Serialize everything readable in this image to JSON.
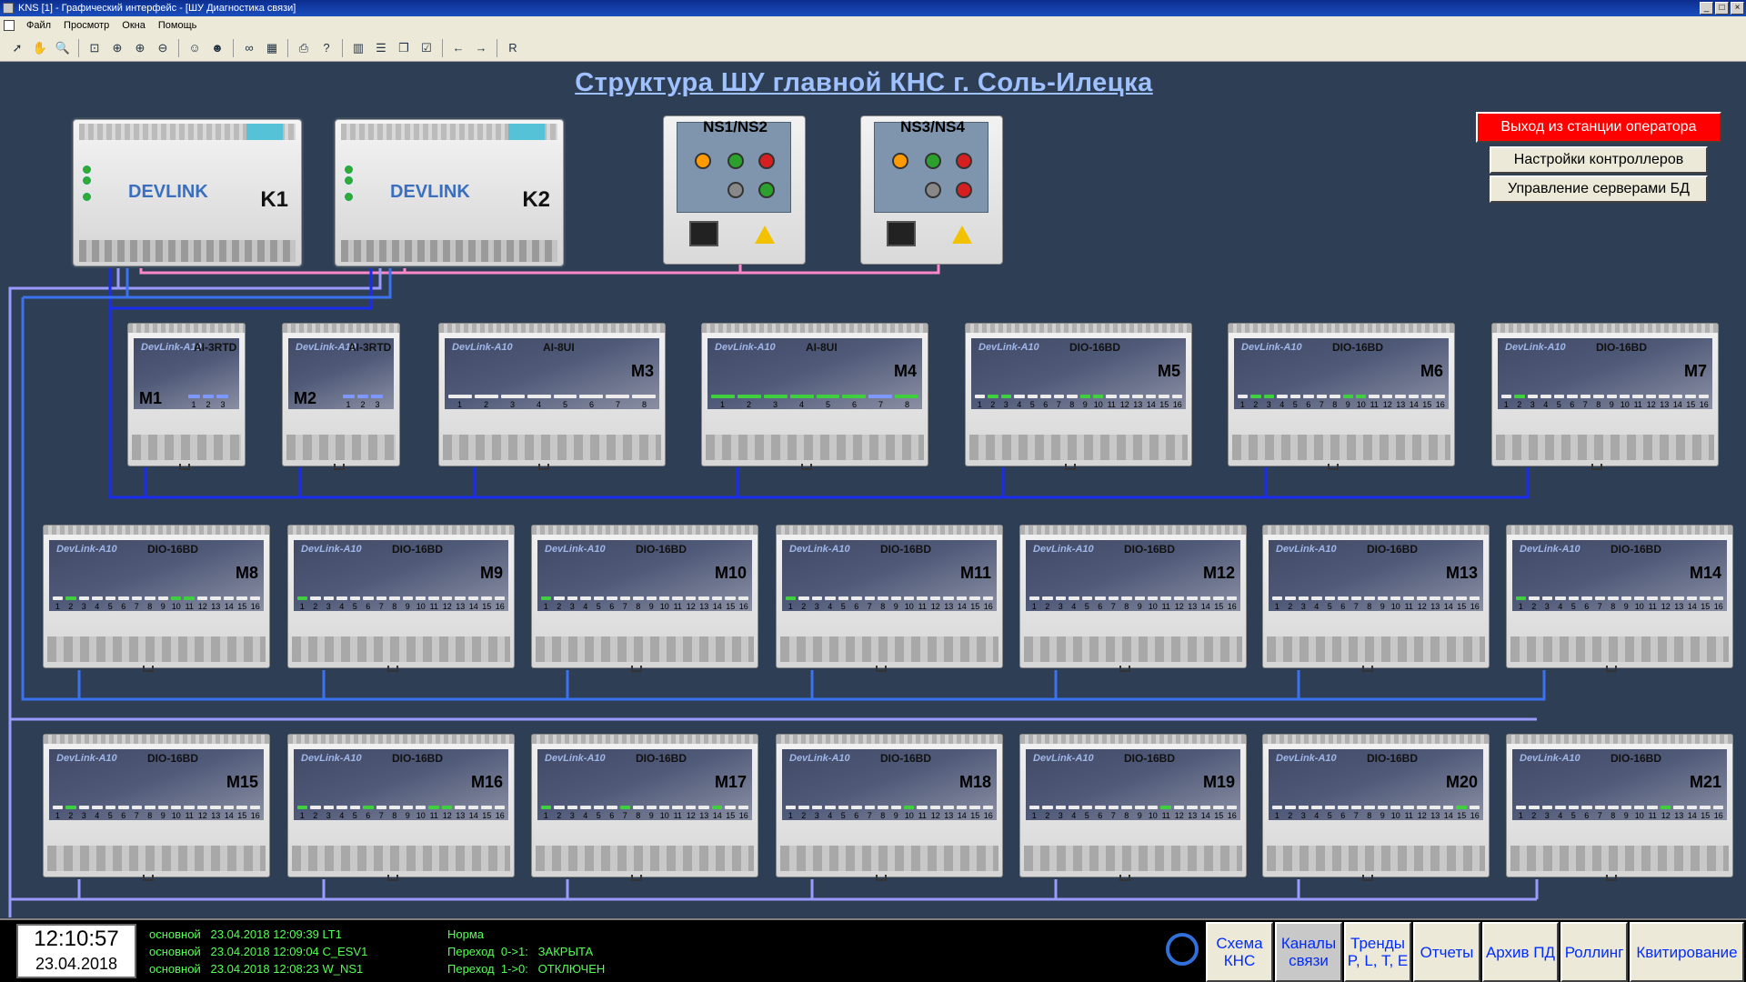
{
  "window": {
    "title": "KNS [1] - Графический интерфейс - [ШУ Диагностика связи]"
  },
  "menu": {
    "items": [
      "Файл",
      "Просмотр",
      "Окна",
      "Помощь"
    ]
  },
  "toolbar": {
    "r_label": "R"
  },
  "screen": {
    "title": "Структура ШУ главной КНС г. Соль-Илецка",
    "controllers": [
      {
        "tag": "K1",
        "brand": "DEVLINK"
      },
      {
        "tag": "K2",
        "brand": "DEVLINK"
      }
    ],
    "relays": [
      {
        "tag": "NS1/NS2"
      },
      {
        "tag": "NS3/NS4"
      }
    ],
    "buttons": {
      "exit": "Выход из станции оператора",
      "controllers": "Настройки контроллеров",
      "db_servers": "Управление серверами БД"
    },
    "modules": [
      {
        "id": "M1",
        "type": "AI-3RTD",
        "n": 3,
        "on": [],
        "blue": [
          0,
          1,
          2
        ]
      },
      {
        "id": "M2",
        "type": "AI-3RTD",
        "n": 3,
        "on": [],
        "blue": [
          0,
          1,
          2
        ]
      },
      {
        "id": "M3",
        "type": "AI-8UI",
        "n": 8,
        "on": [],
        "blue": []
      },
      {
        "id": "M4",
        "type": "AI-8UI",
        "n": 8,
        "on": [
          0,
          1,
          2,
          3,
          4,
          5,
          7
        ],
        "blue": [
          6
        ]
      },
      {
        "id": "M5",
        "type": "DIO-16BD",
        "n": 16,
        "on": [
          1,
          2,
          8,
          9
        ],
        "blue": []
      },
      {
        "id": "M6",
        "type": "DIO-16BD",
        "n": 16,
        "on": [
          1,
          2,
          8,
          9
        ],
        "blue": []
      },
      {
        "id": "M7",
        "type": "DIO-16BD",
        "n": 16,
        "on": [
          1
        ],
        "blue": []
      },
      {
        "id": "M8",
        "type": "DIO-16BD",
        "n": 16,
        "on": [
          1,
          9,
          10
        ],
        "blue": []
      },
      {
        "id": "M9",
        "type": "DIO-16BD",
        "n": 16,
        "on": [
          0
        ],
        "blue": []
      },
      {
        "id": "M10",
        "type": "DIO-16BD",
        "n": 16,
        "on": [
          0
        ],
        "blue": []
      },
      {
        "id": "M11",
        "type": "DIO-16BD",
        "n": 16,
        "on": [
          0
        ],
        "blue": []
      },
      {
        "id": "M12",
        "type": "DIO-16BD",
        "n": 16,
        "on": [],
        "blue": []
      },
      {
        "id": "M13",
        "type": "DIO-16BD",
        "n": 16,
        "on": [],
        "blue": []
      },
      {
        "id": "M14",
        "type": "DIO-16BD",
        "n": 16,
        "on": [
          0
        ],
        "blue": []
      },
      {
        "id": "M15",
        "type": "DIO-16BD",
        "n": 16,
        "on": [
          1
        ],
        "blue": []
      },
      {
        "id": "M16",
        "type": "DIO-16BD",
        "n": 16,
        "on": [
          0,
          5,
          10,
          11
        ],
        "blue": []
      },
      {
        "id": "M17",
        "type": "DIO-16BD",
        "n": 16,
        "on": [
          0,
          6,
          13
        ],
        "blue": []
      },
      {
        "id": "M18",
        "type": "DIO-16BD",
        "n": 16,
        "on": [
          9
        ],
        "blue": []
      },
      {
        "id": "M19",
        "type": "DIO-16BD",
        "n": 16,
        "on": [
          10
        ],
        "blue": []
      },
      {
        "id": "M20",
        "type": "DIO-16BD",
        "n": 16,
        "on": [
          14
        ],
        "blue": []
      },
      {
        "id": "M21",
        "type": "DIO-16BD",
        "n": 16,
        "on": [
          11
        ],
        "blue": []
      }
    ]
  },
  "status": {
    "time": "12:10:57",
    "date": "23.04.2018",
    "log": [
      {
        "left": "основной   23.04.2018 12:09:39 LT1",
        "right": "Норма"
      },
      {
        "left": "основной   23.04.2018 12:09:04 C_ESV1",
        "right": "Переход  0->1:   ЗАКРЫТА"
      },
      {
        "left": "основной   23.04.2018 12:08:23 W_NS1",
        "right": "Переход  1->0:   ОТКЛЮЧЕН"
      }
    ],
    "nav": [
      {
        "l1": "Схема",
        "l2": "КНС"
      },
      {
        "l1": "Каналы",
        "l2": "связи"
      },
      {
        "l1": "Тренды",
        "l2": "P, L, T, E"
      },
      {
        "l1": "Отчеты",
        "l2": ""
      },
      {
        "l1": "Архив ПД",
        "l2": ""
      },
      {
        "l1": "Роллинг",
        "l2": ""
      },
      {
        "l1": "Квитирование",
        "l2": ""
      }
    ]
  }
}
